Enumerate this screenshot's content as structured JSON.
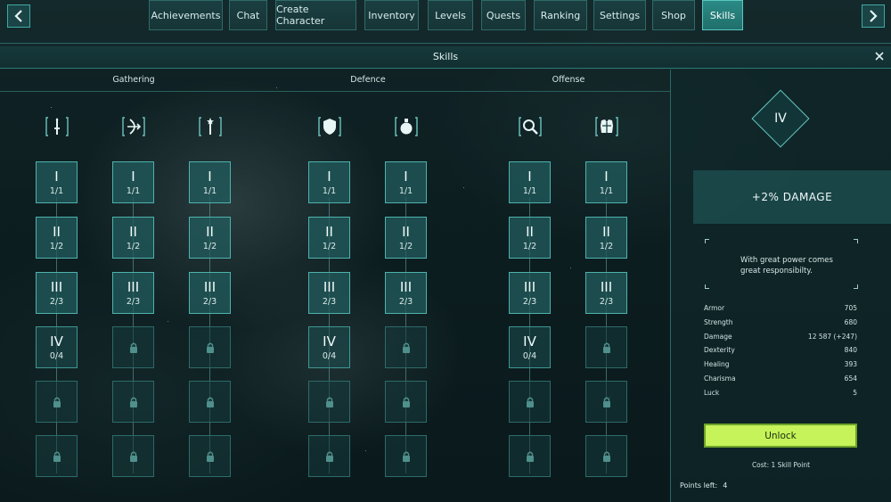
{
  "nav": {
    "tabs": [
      {
        "label": "Achievements",
        "active": false
      },
      {
        "label": "Chat",
        "active": false
      },
      {
        "label": "Create Character",
        "active": false
      },
      {
        "label": "Inventory",
        "active": false
      },
      {
        "label": "Levels",
        "active": false
      },
      {
        "label": "Quests",
        "active": false
      },
      {
        "label": "Ranking",
        "active": false
      },
      {
        "label": "Settings",
        "active": false
      },
      {
        "label": "Shop",
        "active": false
      },
      {
        "label": "Skills",
        "active": true
      }
    ],
    "prev_icon": "chevron-left-icon",
    "next_icon": "chevron-right-icon"
  },
  "panel": {
    "title": "Skills",
    "close_icon": "close-icon"
  },
  "categories": [
    "Gathering",
    "Defence",
    "Offense"
  ],
  "branches": [
    {
      "icon": "sword-icon",
      "nodes": [
        {
          "roman": "I",
          "count": "1/1",
          "state": "unlocked"
        },
        {
          "roman": "II",
          "count": "1/2",
          "state": "unlocked"
        },
        {
          "roman": "III",
          "count": "2/3",
          "state": "unlocked"
        },
        {
          "roman": "IV",
          "count": "0/4",
          "state": "available"
        },
        {
          "state": "locked"
        },
        {
          "state": "locked"
        }
      ]
    },
    {
      "icon": "bow-arrow-icon",
      "nodes": [
        {
          "roman": "I",
          "count": "1/1",
          "state": "unlocked"
        },
        {
          "roman": "II",
          "count": "1/2",
          "state": "unlocked"
        },
        {
          "roman": "III",
          "count": "2/3",
          "state": "unlocked"
        },
        {
          "state": "locked"
        },
        {
          "state": "locked"
        },
        {
          "state": "locked"
        }
      ]
    },
    {
      "icon": "magic-wand-icon",
      "nodes": [
        {
          "roman": "I",
          "count": "1/1",
          "state": "unlocked"
        },
        {
          "roman": "II",
          "count": "1/2",
          "state": "unlocked"
        },
        {
          "roman": "III",
          "count": "2/3",
          "state": "unlocked"
        },
        {
          "state": "locked"
        },
        {
          "state": "locked"
        },
        {
          "state": "locked"
        }
      ]
    },
    {
      "icon": "shield-icon",
      "nodes": [
        {
          "roman": "I",
          "count": "1/1",
          "state": "unlocked"
        },
        {
          "roman": "II",
          "count": "1/2",
          "state": "unlocked"
        },
        {
          "roman": "III",
          "count": "2/3",
          "state": "unlocked"
        },
        {
          "roman": "IV",
          "count": "0/4",
          "state": "available"
        },
        {
          "state": "locked"
        },
        {
          "state": "locked"
        }
      ]
    },
    {
      "icon": "potion-icon",
      "nodes": [
        {
          "roman": "I",
          "count": "1/1",
          "state": "unlocked"
        },
        {
          "roman": "II",
          "count": "1/2",
          "state": "unlocked"
        },
        {
          "roman": "III",
          "count": "2/3",
          "state": "unlocked"
        },
        {
          "state": "locked"
        },
        {
          "state": "locked"
        },
        {
          "state": "locked"
        }
      ]
    },
    {
      "icon": "magnifier-icon",
      "nodes": [
        {
          "roman": "I",
          "count": "1/1",
          "state": "unlocked"
        },
        {
          "roman": "II",
          "count": "1/2",
          "state": "unlocked"
        },
        {
          "roman": "III",
          "count": "2/3",
          "state": "unlocked"
        },
        {
          "roman": "IV",
          "count": "0/4",
          "state": "available"
        },
        {
          "state": "locked"
        },
        {
          "state": "locked"
        }
      ]
    },
    {
      "icon": "armor-icon",
      "nodes": [
        {
          "roman": "I",
          "count": "1/1",
          "state": "unlocked"
        },
        {
          "roman": "II",
          "count": "1/2",
          "state": "unlocked"
        },
        {
          "roman": "III",
          "count": "2/3",
          "state": "unlocked"
        },
        {
          "state": "locked"
        },
        {
          "state": "locked"
        },
        {
          "state": "locked"
        }
      ]
    }
  ],
  "detail": {
    "tier": "IV",
    "effect": "+2% DAMAGE",
    "description": "With great power comes great responsibilty.",
    "stats": [
      {
        "label": "Armor",
        "value": "705"
      },
      {
        "label": "Strength",
        "value": "680"
      },
      {
        "label": "Damage",
        "value": "12 587 (+247)"
      },
      {
        "label": "Dexterity",
        "value": "840"
      },
      {
        "label": "Healing",
        "value": "393"
      },
      {
        "label": "Charisma",
        "value": "654"
      },
      {
        "label": "Luck",
        "value": "5"
      }
    ],
    "unlock_label": "Unlock",
    "cost": "Cost: 1 Skill Point",
    "points_label": "Points left:",
    "points_value": "4"
  },
  "colors": {
    "accent": "#2b8a85",
    "unlock_button": "#c6f35a",
    "border": "#3f9692"
  }
}
